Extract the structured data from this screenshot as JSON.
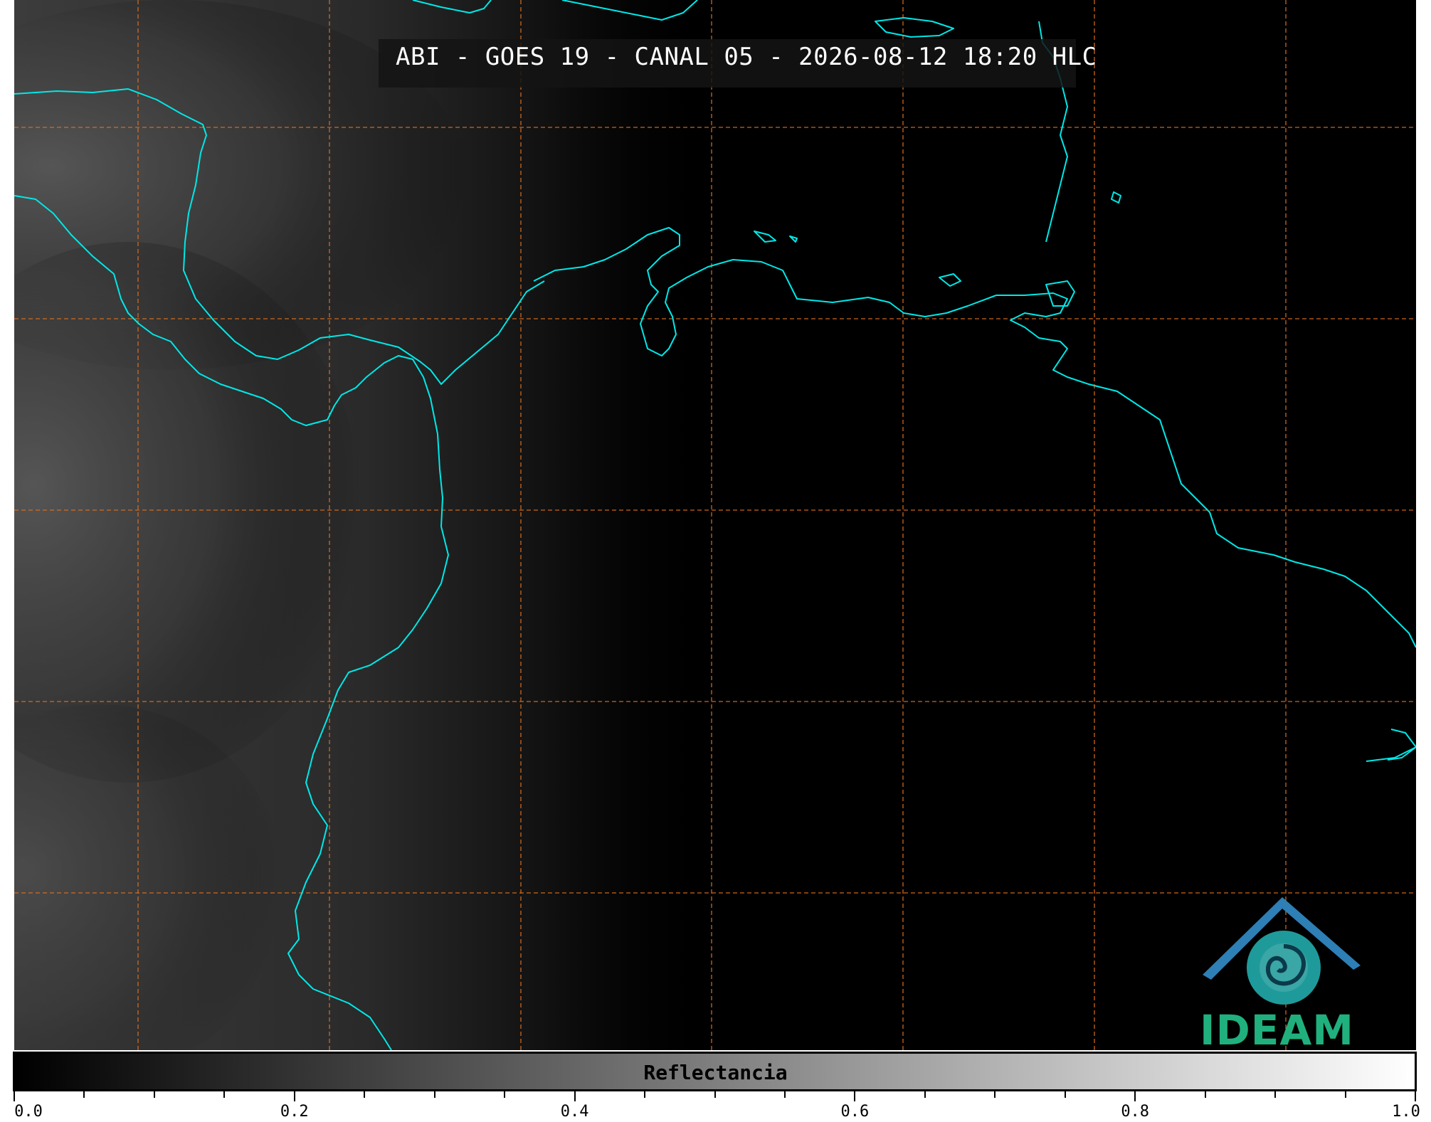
{
  "title": "ABI - GOES 19 - CANAL 05 - 2026-08-12 18:20 HLC",
  "logo_text": "IDEAM",
  "colorbar": {
    "label": "Reflectancia",
    "range": [
      0.0,
      1.0
    ],
    "ticks": [
      "0.0",
      "0.2",
      "0.4",
      "0.6",
      "0.8",
      "1.0"
    ],
    "minor_step": 0.05,
    "colors": {
      "start": "#000000",
      "end": "#ffffff"
    }
  },
  "colors": {
    "coastline": "#00e8e8",
    "grid": "#e07020",
    "background": "#000000",
    "cloud_tint": "#4a4a4a",
    "logo_blue": "#2d7fb6",
    "logo_green": "#20b07e"
  },
  "map": {
    "grid_lines": "dashed",
    "layers": [
      "coastlines",
      "lat-lon-grid",
      "cloud-imagery"
    ]
  }
}
